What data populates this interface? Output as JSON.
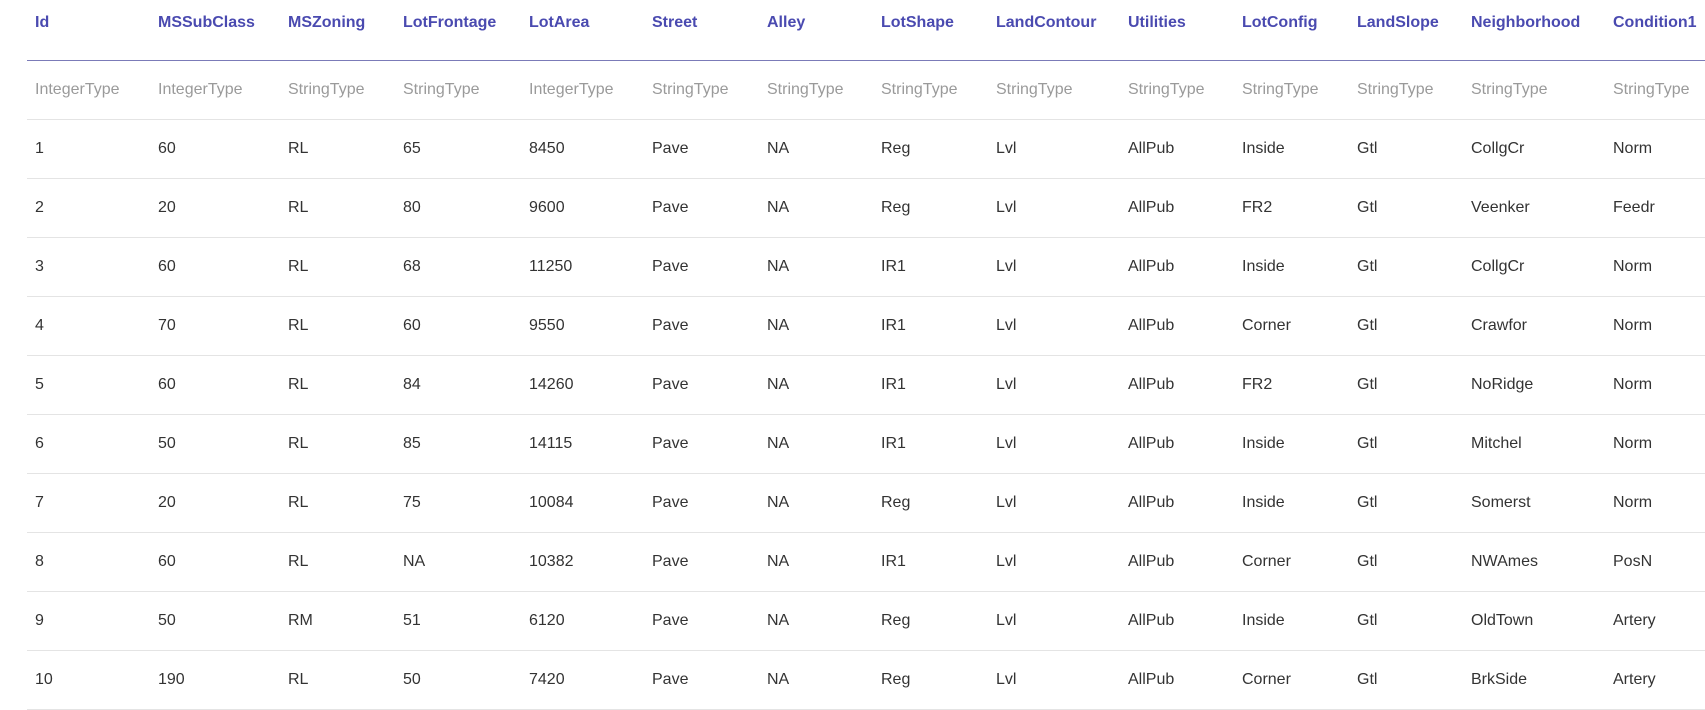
{
  "table": {
    "columns": [
      "Id",
      "MSSubClass",
      "MSZoning",
      "LotFrontage",
      "LotArea",
      "Street",
      "Alley",
      "LotShape",
      "LandContour",
      "Utilities",
      "LotConfig",
      "LandSlope",
      "Neighborhood",
      "Condition1"
    ],
    "types": [
      "IntegerType",
      "IntegerType",
      "StringType",
      "StringType",
      "IntegerType",
      "StringType",
      "StringType",
      "StringType",
      "StringType",
      "StringType",
      "StringType",
      "StringType",
      "StringType",
      "StringType"
    ],
    "rows": [
      [
        "1",
        "60",
        "RL",
        "65",
        "8450",
        "Pave",
        "NA",
        "Reg",
        "Lvl",
        "AllPub",
        "Inside",
        "Gtl",
        "CollgCr",
        "Norm"
      ],
      [
        "2",
        "20",
        "RL",
        "80",
        "9600",
        "Pave",
        "NA",
        "Reg",
        "Lvl",
        "AllPub",
        "FR2",
        "Gtl",
        "Veenker",
        "Feedr"
      ],
      [
        "3",
        "60",
        "RL",
        "68",
        "11250",
        "Pave",
        "NA",
        "IR1",
        "Lvl",
        "AllPub",
        "Inside",
        "Gtl",
        "CollgCr",
        "Norm"
      ],
      [
        "4",
        "70",
        "RL",
        "60",
        "9550",
        "Pave",
        "NA",
        "IR1",
        "Lvl",
        "AllPub",
        "Corner",
        "Gtl",
        "Crawfor",
        "Norm"
      ],
      [
        "5",
        "60",
        "RL",
        "84",
        "14260",
        "Pave",
        "NA",
        "IR1",
        "Lvl",
        "AllPub",
        "FR2",
        "Gtl",
        "NoRidge",
        "Norm"
      ],
      [
        "6",
        "50",
        "RL",
        "85",
        "14115",
        "Pave",
        "NA",
        "IR1",
        "Lvl",
        "AllPub",
        "Inside",
        "Gtl",
        "Mitchel",
        "Norm"
      ],
      [
        "7",
        "20",
        "RL",
        "75",
        "10084",
        "Pave",
        "NA",
        "Reg",
        "Lvl",
        "AllPub",
        "Inside",
        "Gtl",
        "Somerst",
        "Norm"
      ],
      [
        "8",
        "60",
        "RL",
        "NA",
        "10382",
        "Pave",
        "NA",
        "IR1",
        "Lvl",
        "AllPub",
        "Corner",
        "Gtl",
        "NWAmes",
        "PosN"
      ],
      [
        "9",
        "50",
        "RM",
        "51",
        "6120",
        "Pave",
        "NA",
        "Reg",
        "Lvl",
        "AllPub",
        "Inside",
        "Gtl",
        "OldTown",
        "Artery"
      ],
      [
        "10",
        "190",
        "RL",
        "50",
        "7420",
        "Pave",
        "NA",
        "Reg",
        "Lvl",
        "AllPub",
        "Corner",
        "Gtl",
        "BrkSide",
        "Artery"
      ]
    ]
  }
}
